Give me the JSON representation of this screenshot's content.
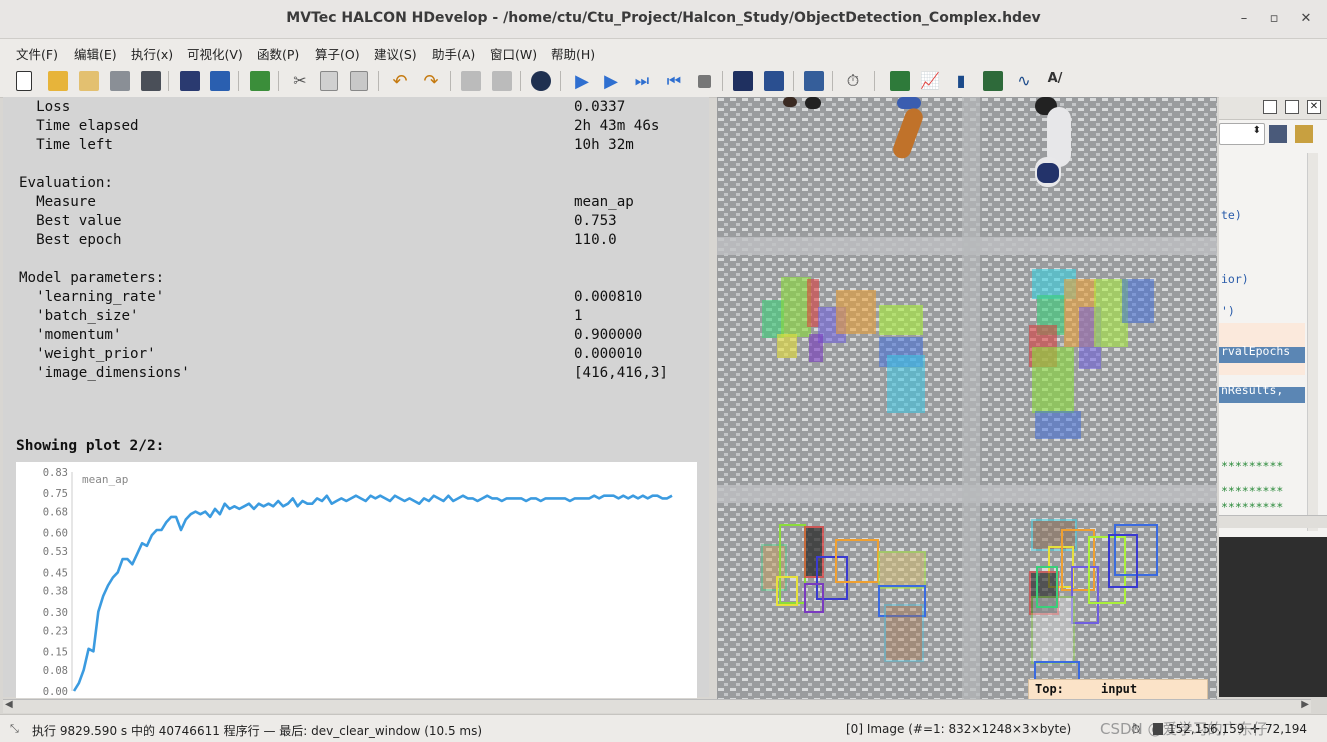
{
  "window": {
    "title": "MVTec HALCON HDevelop - /home/ctu/Ctu_Project/Halcon_Study/ObjectDetection_Complex.hdev",
    "minimize": "–",
    "maximize": "▫",
    "close": "✕"
  },
  "menu": [
    "文件(F)",
    "编辑(E)",
    "执行(x)",
    "可视化(V)",
    "函数(P)",
    "算子(O)",
    "建议(S)",
    "助手(A)",
    "窗口(W)",
    "帮助(H)"
  ],
  "training_output": {
    "rows": [
      {
        "label": "  Loss",
        "value": "0.0337"
      },
      {
        "label": "  Time elapsed",
        "value": "2h 43m 46s"
      },
      {
        "label": "  Time left",
        "value": "10h 32m"
      },
      {
        "label": "",
        "value": ""
      },
      {
        "label": "Evaluation:",
        "value": ""
      },
      {
        "label": "  Measure",
        "value": "mean_ap"
      },
      {
        "label": "  Best value",
        "value": "0.753"
      },
      {
        "label": "  Best epoch",
        "value": "110.0"
      },
      {
        "label": "",
        "value": ""
      },
      {
        "label": "Model parameters:",
        "value": ""
      },
      {
        "label": "  'learning_rate'",
        "value": "0.000810"
      },
      {
        "label": "  'batch_size'",
        "value": "1"
      },
      {
        "label": "  'momentum'",
        "value": "0.900000"
      },
      {
        "label": "  'weight_prior'",
        "value": "0.000010"
      },
      {
        "label": "  'image_dimensions'",
        "value": "[416,416,3]"
      }
    ],
    "plot_caption": "Showing plot 2/2:"
  },
  "chart_data": {
    "type": "line",
    "series": [
      {
        "name": "mean_ap",
        "color": "#3b9be0",
        "values": [
          0.0,
          0.03,
          0.08,
          0.16,
          0.15,
          0.3,
          0.36,
          0.4,
          0.43,
          0.45,
          0.5,
          0.5,
          0.48,
          0.52,
          0.56,
          0.55,
          0.59,
          0.61,
          0.61,
          0.64,
          0.66,
          0.66,
          0.61,
          0.65,
          0.67,
          0.68,
          0.67,
          0.68,
          0.66,
          0.69,
          0.67,
          0.71,
          0.69,
          0.7,
          0.69,
          0.7,
          0.71,
          0.69,
          0.71,
          0.7,
          0.71,
          0.7,
          0.72,
          0.7,
          0.71,
          0.73,
          0.7,
          0.72,
          0.71,
          0.71,
          0.73,
          0.72,
          0.74,
          0.71,
          0.72,
          0.73,
          0.72,
          0.73,
          0.74,
          0.73,
          0.72,
          0.74,
          0.73,
          0.74,
          0.73,
          0.72,
          0.74,
          0.73,
          0.72,
          0.73,
          0.72,
          0.71,
          0.73,
          0.72,
          0.74,
          0.73,
          0.72,
          0.74,
          0.72,
          0.73,
          0.74,
          0.73,
          0.73,
          0.72,
          0.73,
          0.74,
          0.73,
          0.73,
          0.72,
          0.73,
          0.73,
          0.73,
          0.73,
          0.72,
          0.73,
          0.73,
          0.72,
          0.73,
          0.73,
          0.73,
          0.73,
          0.73,
          0.72,
          0.73,
          0.73,
          0.73,
          0.73,
          0.74,
          0.73,
          0.74,
          0.74,
          0.74,
          0.73,
          0.74,
          0.73,
          0.74,
          0.73,
          0.74,
          0.73,
          0.74,
          0.74,
          0.73,
          0.73,
          0.74
        ]
      }
    ],
    "y_ticks": [
      "0.83",
      "0.75",
      "0.68",
      "0.60",
      "0.53",
      "0.45",
      "0.38",
      "0.30",
      "0.23",
      "0.15",
      "0.08",
      "0.00"
    ],
    "ylim": [
      0,
      0.83
    ],
    "legend_label": "mean_ap",
    "grid": false
  },
  "image_window": {
    "tooltip_label": "Top:",
    "tooltip_value": "input"
  },
  "program_editor": {
    "lines": [
      "te)",
      "ior)",
      "')",
      "rvalEpochs",
      "nResults, ",
      "*********",
      "*********",
      "*********"
    ]
  },
  "status": {
    "execution": "执行 9829.590 s 中的 40746611 程序行 — 最后: dev_clear_window (10.5 ms)",
    "image_info": "[0] Image (#=1: 832×1248×3×byte)",
    "pixel_value": "152,156,159",
    "coords": "72,194",
    "watermark": "CSDN @爱学习的广东仔"
  }
}
